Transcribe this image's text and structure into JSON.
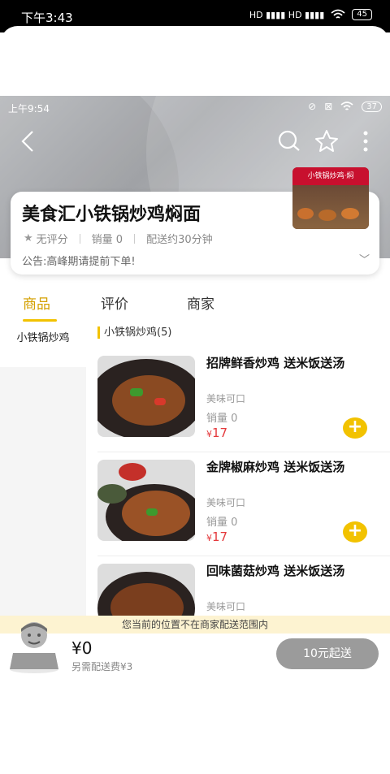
{
  "outer_status": {
    "time": "下午3:43",
    "network": "HD ▮▮▮▮ HD ▮▮▮▮",
    "battery": "45"
  },
  "inner_status": {
    "time": "上午9:54",
    "battery": "37"
  },
  "store": {
    "name": "美食汇小铁锅炒鸡焖面",
    "rating": "无评分",
    "sales": "销量 0",
    "delivery_time": "配送约30分钟",
    "notice": "公告:高峰期请提前下单!",
    "photo_sign": "小铁锅炒鸡·焖"
  },
  "tabs": [
    {
      "label": "商品",
      "active": true
    },
    {
      "label": "评价",
      "active": false
    },
    {
      "label": "商家",
      "active": false
    }
  ],
  "sidebar": {
    "selected_category": "小铁锅炒鸡"
  },
  "category_title": "小铁锅炒鸡(5)",
  "products": [
    {
      "name": "招牌鲜香炒鸡 送米饭送汤",
      "desc": "美味可口",
      "sales": "销量 0",
      "currency": "¥",
      "price": "17"
    },
    {
      "name": "金牌椒麻炒鸡 送米饭送汤",
      "desc": "美味可口",
      "sales": "销量 0",
      "currency": "¥",
      "price": "17"
    },
    {
      "name": "回味菌菇炒鸡 送米饭送汤",
      "desc": "美味可口",
      "sales": "",
      "currency": "",
      "price": ""
    }
  ],
  "location_notice": "您当前的位置不在商家配送范围内",
  "cart": {
    "total": "¥0",
    "delivery_fee": "另需配送费¥3",
    "min_order_button": "10元起送"
  },
  "colors": {
    "accent": "#f2c200",
    "price": "#e4393c",
    "button_gray": "#9b9b9b"
  }
}
